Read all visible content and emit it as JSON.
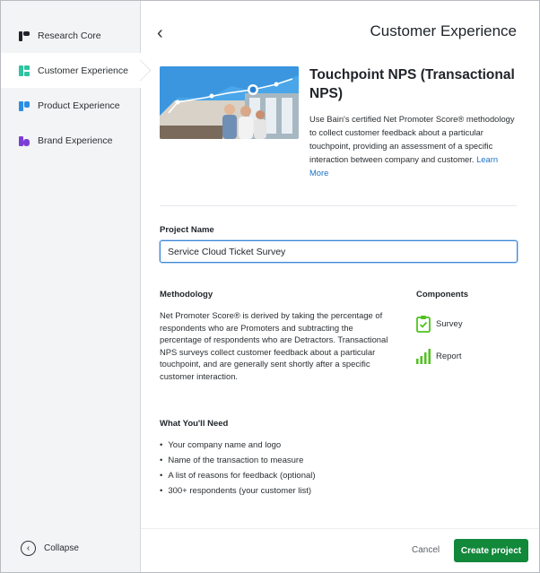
{
  "sidebar": {
    "items": [
      {
        "label": "Research Core",
        "icon": "research-core-icon",
        "color": "#1f2329"
      },
      {
        "label": "Customer Experience",
        "icon": "customer-experience-icon",
        "color": "#2ec4a0"
      },
      {
        "label": "Product Experience",
        "icon": "product-experience-icon",
        "color": "#2a8ee6"
      },
      {
        "label": "Brand Experience",
        "icon": "brand-experience-icon",
        "color": "#7b3fd6"
      }
    ],
    "active_index": 1,
    "collapse_label": "Collapse"
  },
  "header": {
    "title": "Customer Experience",
    "back_icon": "chevron-left-icon"
  },
  "project": {
    "title": "Touchpoint NPS (Transactional NPS)",
    "description": "Use Bain's certified Net Promoter Score® methodology to collect customer feedback about a particular touchpoint, providing an assessment of a specific interaction between company and customer.",
    "learn_more": "Learn More"
  },
  "form": {
    "project_name_label": "Project Name",
    "project_name_value": "Service Cloud Ticket Survey"
  },
  "methodology": {
    "heading": "Methodology",
    "text": "Net Promoter Score® is derived by taking the percentage of respondents who are Promoters and subtracting the percentage of respondents who are Detractors. Transactional NPS surveys collect customer feedback about a particular touchpoint, and are generally sent shortly after a specific customer interaction."
  },
  "components": {
    "heading": "Components",
    "items": [
      {
        "label": "Survey",
        "icon": "survey-clipboard-icon"
      },
      {
        "label": "Report",
        "icon": "report-bars-icon"
      }
    ],
    "accent": "#4fc21e"
  },
  "needs": {
    "heading": "What You'll Need",
    "items": [
      "Your company name and logo",
      "Name of the transaction to measure",
      "A list of reasons for feedback (optional)",
      "300+ respondents (your customer list)"
    ]
  },
  "footer": {
    "cancel_label": "Cancel",
    "create_label": "Create project",
    "create_color": "#12883b"
  }
}
